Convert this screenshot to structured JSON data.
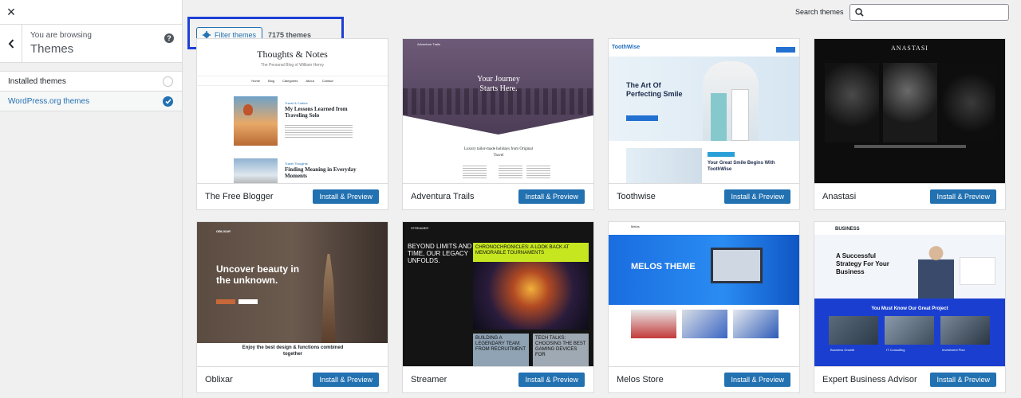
{
  "close_label": "×",
  "sidebar": {
    "browsing_small": "You are browsing",
    "browsing_title": "Themes",
    "help": "?",
    "sources": [
      {
        "label": "Installed themes",
        "selected": false
      },
      {
        "label": "WordPress.org themes",
        "selected": true
      }
    ]
  },
  "search": {
    "label": "Search themes",
    "value": "",
    "placeholder": ""
  },
  "filter": {
    "label": "Filter themes",
    "count": "7175 themes"
  },
  "accent": "#2271b1",
  "install_label": "Install & Preview",
  "themes": [
    {
      "name": "The Free Blogger",
      "preview": {
        "title": "Thoughts & Notes",
        "subtitle": "The Personal Blog of William Henry",
        "nav": [
          "Home",
          "Blog",
          "Categories",
          "About",
          "Contact"
        ],
        "tag1": "Travel & Culture",
        "post1": "My Lessons Learned from Traveling Solo",
        "tag2": "Travel Thoughts",
        "post2": "Finding Meaning in Everyday Moments"
      }
    },
    {
      "name": "Adventura Trails",
      "preview": {
        "brand": "Adventure Trails",
        "heading": "Your Journey Starts Here.",
        "sub": "Luxury tailor-made holidays from Original Travel"
      }
    },
    {
      "name": "Toothwise",
      "preview": {
        "brand": "ToothWise",
        "heading": "The Art Of Perfecting Smile",
        "sub": "Your Great Smile Begins With ToothWise"
      }
    },
    {
      "name": "Anastasi",
      "preview": {
        "brand": "ANASTASI"
      }
    },
    {
      "name": "Oblixar",
      "preview": {
        "brand": "OBLIXAR",
        "heading": "Uncover beauty in the unknown.",
        "sub": "Enjoy the best design & functions combined together"
      }
    },
    {
      "name": "Streamer",
      "preview": {
        "brand": "STREAMER",
        "heading": "BEYOND LIMITS AND TIME, OUR LEGACY UNFOLDS.",
        "banner": "CHRONOCHRONICLES: A LOOK BACK AT MEMORABLE TOURNAMENTS",
        "tile1": "BUILDING A LEGENDARY TEAM: FROM RECRUITMENT",
        "tile2": "TECH TALKS: CHOOSING THE BEST GAMING DEVICES FOR"
      }
    },
    {
      "name": "Melos Store",
      "preview": {
        "brand": "Melos",
        "heading": "MELOS THEME"
      }
    },
    {
      "name": "Expert Business Advisor",
      "preview": {
        "brand": "BUSINESS",
        "heading": "A Successful Strategy For Your Business",
        "sub": "You Must Know Our Great Project",
        "items": [
          "Business Growth",
          "IT Consulting",
          "Investment Plan"
        ]
      }
    }
  ]
}
